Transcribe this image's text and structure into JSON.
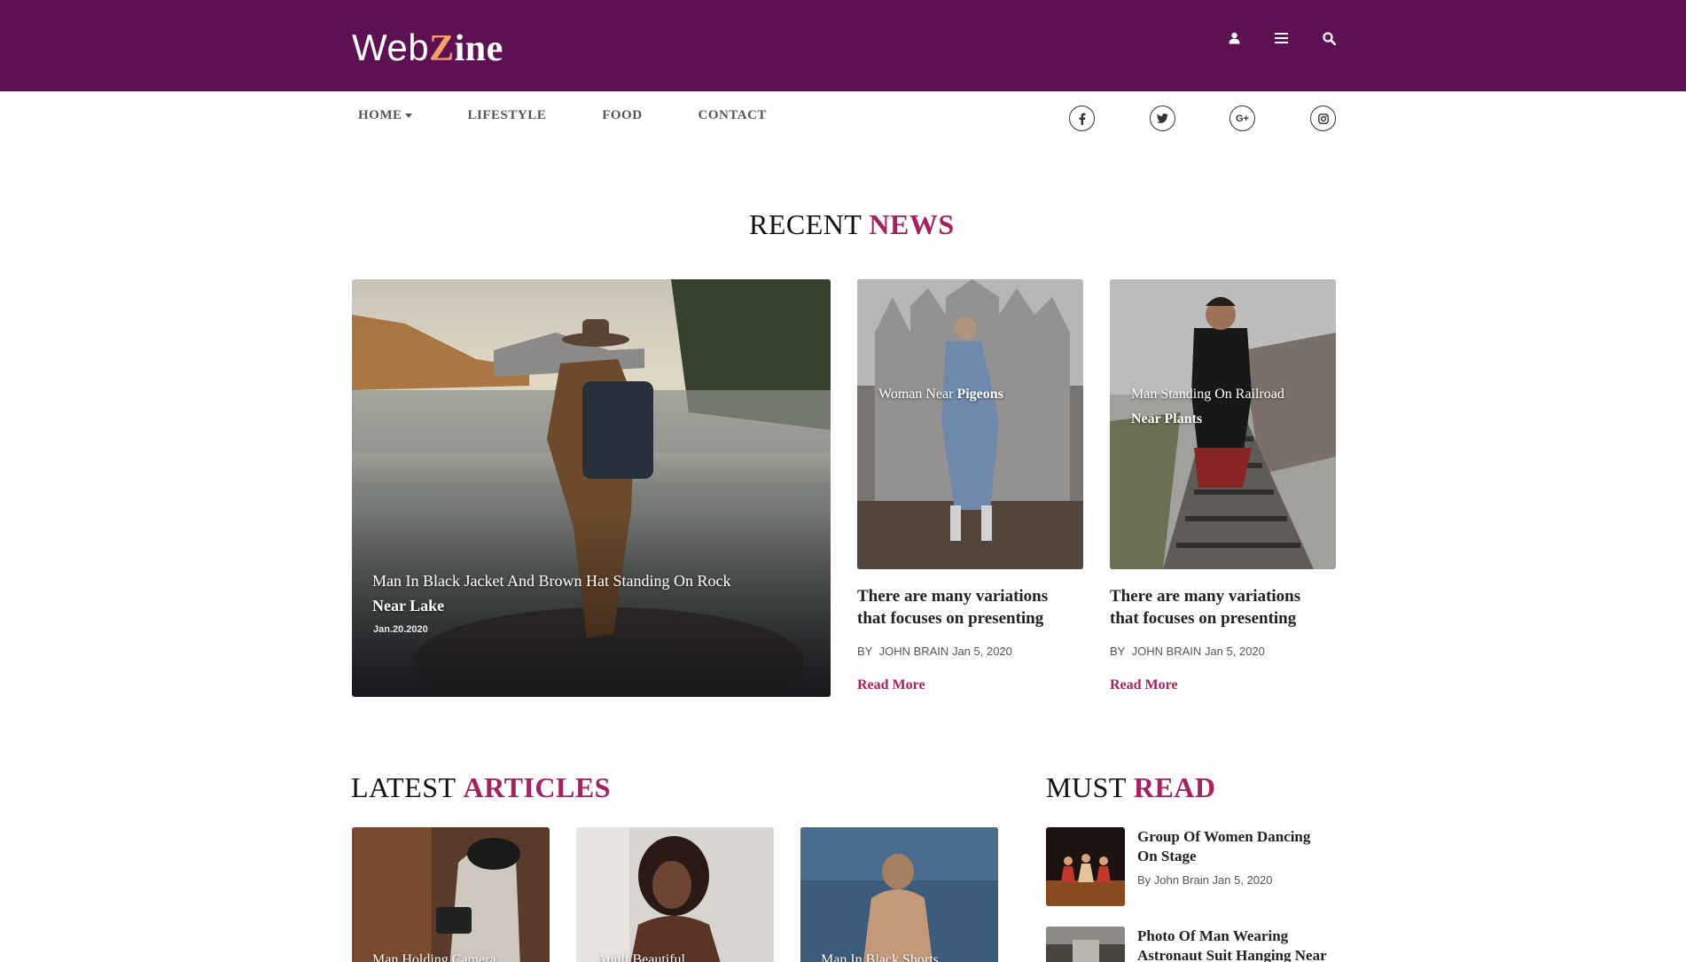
{
  "header": {
    "logo_web": "Web",
    "logo_z": "Z",
    "logo_ine": "ine",
    "icons": [
      "user-icon",
      "menu-icon",
      "search-icon"
    ],
    "background": "#5e1152"
  },
  "nav": {
    "items": [
      {
        "label": "HOME",
        "has_dropdown": true
      },
      {
        "label": "LIFESTYLE"
      },
      {
        "label": "FOOD"
      },
      {
        "label": "CONTACT"
      }
    ],
    "social": [
      {
        "icon": "facebook-icon",
        "glyph": "f"
      },
      {
        "icon": "twitter-icon",
        "glyph": "t"
      },
      {
        "icon": "google-plus-icon",
        "glyph": "G+"
      },
      {
        "icon": "instagram-icon",
        "glyph": "◎"
      }
    ]
  },
  "recent_news": {
    "title_plain": "RECENT",
    "title_accent": "NEWS",
    "featured": {
      "title_line1": "Man In Black Jacket And Brown Hat Standing On Rock",
      "title_line2": "Near Lake",
      "date": "Jan.20.2020"
    },
    "cards": [
      {
        "overlay_plain": "Woman Near ",
        "overlay_bold": "Pigeons",
        "overlay_line2": "",
        "title_line1": "There are many variations",
        "title_line2": "that focuses on presenting",
        "by": "BY",
        "author": "JOHN BRAIN",
        "date": "Jan 5, 2020",
        "read_more": "Read More"
      },
      {
        "overlay_plain": "Man Standing On Railroad",
        "overlay_bold": "",
        "overlay_line2": "Near Plants",
        "title_line1": "There are many variations",
        "title_line2": "that focuses on presenting",
        "by": "BY",
        "author": "JOHN BRAIN",
        "date": "Jan 5, 2020",
        "read_more": "Read More"
      }
    ]
  },
  "latest_articles": {
    "title_plain": "LATEST",
    "title_accent": "ARTICLES",
    "items": [
      {
        "overlay": "Man Holding Camera"
      },
      {
        "overlay": "Adult Beautiful"
      },
      {
        "overlay": "Man In Black Shorts"
      }
    ]
  },
  "must_read": {
    "title_plain": "MUST",
    "title_accent": "READ",
    "items": [
      {
        "title_line1": "Group Of Women Dancing",
        "title_line2": "On Stage",
        "meta": "By John Brain Jan 5, 2020"
      },
      {
        "title_line1": "Photo Of Man Wearing",
        "title_line2": "Astronaut Suit Hanging Near",
        "meta": ""
      }
    ]
  },
  "colors": {
    "accent": "#a5215f",
    "header": "#5e1152",
    "logo_z": "#f3a06a"
  }
}
